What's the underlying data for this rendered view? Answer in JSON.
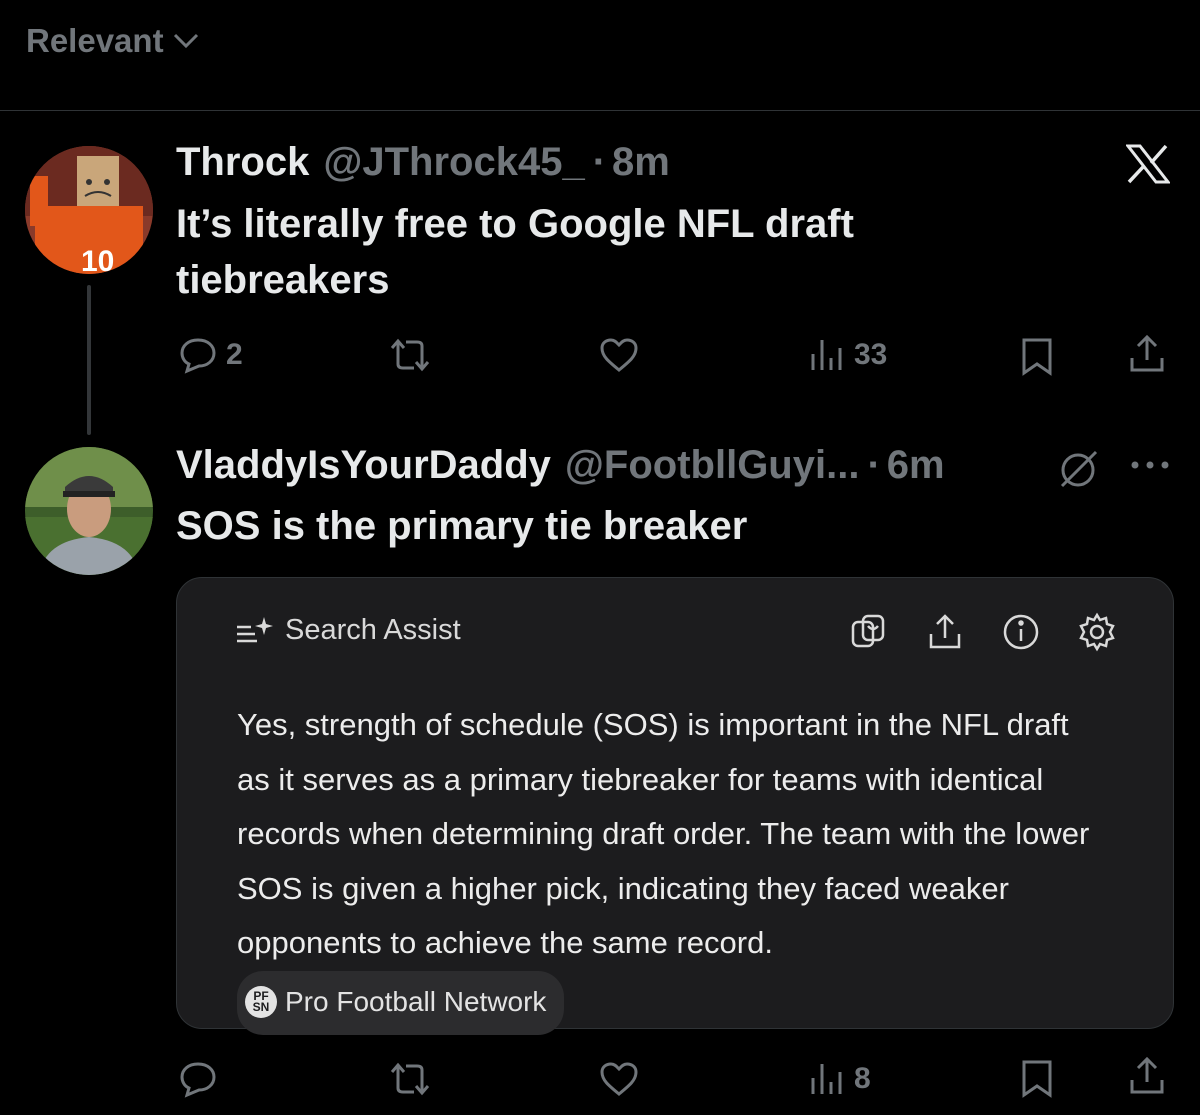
{
  "sort": {
    "label": "Relevant"
  },
  "tweets": [
    {
      "name": "Throck",
      "handle": "@JThrock45_",
      "time": "8m",
      "text": "It’s literally free to Google NFL draft tiebreakers",
      "replies": "2",
      "reposts": "",
      "likes": "",
      "views": "33"
    },
    {
      "name": "VladdyIsYourDaddy",
      "handle": "@FootbllGuyi...",
      "time": "6m",
      "text": "SOS is the primary tie breaker",
      "replies": "",
      "reposts": "",
      "likes": "",
      "views": "8"
    }
  ],
  "search_assist": {
    "title": "Search Assist",
    "body": "Yes, strength of schedule (SOS) is important in the NFL draft as it serves as a primary tiebreaker for teams with identical records when determining draft order. The team with the lower SOS is given a higher pick, indicating they faced weaker opponents to achieve the same record.",
    "source": "Pro Football Network",
    "source_logo": "PF SN"
  },
  "icons": [
    "x-logo-icon",
    "reply-icon",
    "repost-icon",
    "like-icon",
    "views-icon",
    "bookmark-icon",
    "share-icon",
    "grok-icon",
    "more-icon",
    "sparkle-icon",
    "copy-icon",
    "info-icon",
    "gear-icon"
  ],
  "colors": {
    "background": "#000000",
    "muted": "#71767b",
    "text": "#e7e9ea",
    "card": "#1c1c1e"
  }
}
